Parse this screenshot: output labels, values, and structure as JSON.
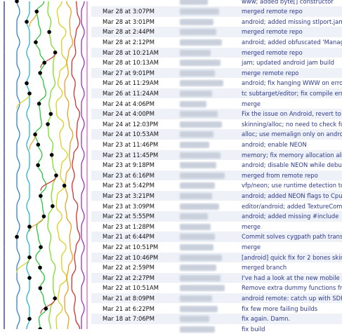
{
  "colors": {
    "link": "#2d3a8c",
    "stripe": "#eef1f7",
    "author_blur": "#c9d0dc"
  },
  "graph": {
    "lane_colors": [
      "#1f2f9e",
      "#2f7fd6",
      "#22b8c8",
      "#27c63a",
      "#7adf26",
      "#d8d21d",
      "#e5a124",
      "#d4302e",
      "#9b2fc7",
      "#e064c8"
    ]
  },
  "commits": [
    {
      "date": "",
      "message": "www; added byte[] constructor"
    },
    {
      "date": "Mar 28 at 3:07PM",
      "message": "merged remote repo"
    },
    {
      "date": "Mar 28 at 3:01PM",
      "message": "android; added missing stlport.jam"
    },
    {
      "date": "Mar 28 at 2:44PM",
      "message": "merged remote repo"
    },
    {
      "date": "Mar 28 at 2:12PM",
      "message": "android; added obfuscated 'Manag"
    },
    {
      "date": "Mar 28 at 10:21AM",
      "message": "merged remote repo"
    },
    {
      "date": "Mar 28 at 10:13AM",
      "message": "jam; updated android jam build"
    },
    {
      "date": "Mar 27 at 9:01PM",
      "message": "merge remote repo"
    },
    {
      "date": "Mar 26 at 11:29AM",
      "message": "android; fix hanging WWW on erro"
    },
    {
      "date": "Mar 26 at 11:24AM",
      "message": "tc subtarget/editor; fix compile err"
    },
    {
      "date": "Mar 24 at 4:06PM",
      "message": "merge"
    },
    {
      "date": "Mar 24 at 4:00PM",
      "message": "Fix the issue on Android, revert to"
    },
    {
      "date": "Mar 24 at 12:03PM",
      "message": "skinning/alloc; no need to check fo"
    },
    {
      "date": "Mar 24 at 10:53AM",
      "message": "alloc; use memalign only on androi"
    },
    {
      "date": "Mar 23 at 11:46PM",
      "message": "android; enable NEON"
    },
    {
      "date": "Mar 23 at 11:45PM",
      "message": "memory; fix memory allocation alig"
    },
    {
      "date": "Mar 23 at 9:18PM",
      "message": "android; disable NEON while debug"
    },
    {
      "date": "Mar 23 at 6:16PM",
      "message": "merged from remote repo"
    },
    {
      "date": "Mar 23 at 5:42PM",
      "message": "vfp/neon; use runtime detection to"
    },
    {
      "date": "Mar 23 at 3:21PM",
      "message": "android; added NEON flags to Cpu"
    },
    {
      "date": "Mar 23 at 3:09PM",
      "message": "editor/android; added TextureComp"
    },
    {
      "date": "Mar 22 at 5:55PM",
      "message": "android; added missing #include"
    },
    {
      "date": "Mar 23 at 1:28PM",
      "message": "merge"
    },
    {
      "date": "Mar 21 at 6:44PM",
      "message": "Commit solves cygpath path trans"
    },
    {
      "date": "Mar 22 at 10:51PM",
      "message": "merge"
    },
    {
      "date": "Mar 22 at 10:46PM",
      "message": "[android] quick fix for 2 bones skin"
    },
    {
      "date": "Mar 22 at 2:59PM",
      "message": "merged branch"
    },
    {
      "date": "Mar 22 at 2:27PM",
      "message": "I've had a look at the new mobile s"
    },
    {
      "date": "Mar 22 at 10:51AM",
      "message": "Remove extra dummy functions fro"
    },
    {
      "date": "Mar 21 at 8:09PM",
      "message": "android remote: catch up with SDK"
    },
    {
      "date": "Mar 21 at 6:22PM",
      "message": "fix few more failing builds"
    },
    {
      "date": "Mar 18 at 7:06PM",
      "message": "fix again. Damn."
    },
    {
      "date": "",
      "message": "fix build"
    }
  ]
}
